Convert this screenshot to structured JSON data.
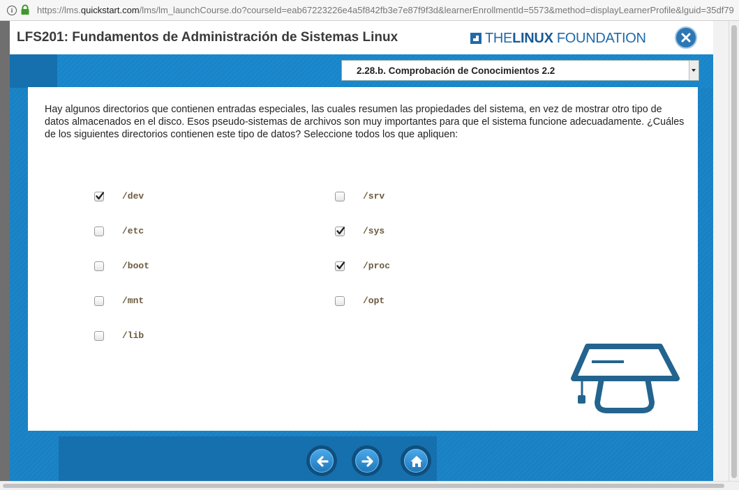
{
  "browser": {
    "url_prefix": "https://lms.",
    "url_host": "quickstart.com",
    "url_rest": "/lms/lm_launchCourse.do?courseId=eab67223226e4a5f842fb3e7e87f9f3d&learnerEnrollmentId=5573&method=displayLearnerProfile&lguid=35df79"
  },
  "course": {
    "title": "LFS201: Fundamentos de Administración de Sistemas Linux",
    "logo_prefix": "THE",
    "logo_bold": "LINUX",
    "logo_suffix": " FOUNDATION",
    "section_select": "2.28.b. Comprobación de Conocimientos 2.2"
  },
  "question": {
    "text": "Hay algunos directorios que contienen entradas especiales, las cuales resumen las propiedades del sistema, en vez de mostrar otro tipo de datos almacenados en el disco. Esos pseudo-sistemas de archivos son muy importantes para que el sistema funcione adecuadamente. ¿Cuáles de los siguientes directorios contienen este tipo de datos? Seleccione todos los que apliquen:",
    "options": [
      {
        "label": "/dev",
        "checked": true
      },
      {
        "label": "/etc",
        "checked": false
      },
      {
        "label": "/boot",
        "checked": false
      },
      {
        "label": "/mnt",
        "checked": false
      },
      {
        "label": "/lib",
        "checked": false
      },
      {
        "label": "/srv",
        "checked": false
      },
      {
        "label": "/sys",
        "checked": true
      },
      {
        "label": "/proc",
        "checked": true
      },
      {
        "label": "/opt",
        "checked": false
      }
    ]
  },
  "navigation": {
    "buttons": [
      "back-icon",
      "forward-icon",
      "home-icon"
    ]
  },
  "colors": {
    "accent": "#1a84c8",
    "header_text": "#3a3a3a",
    "option_text": "#6b5a3e",
    "cap_icon": "#23648f"
  }
}
